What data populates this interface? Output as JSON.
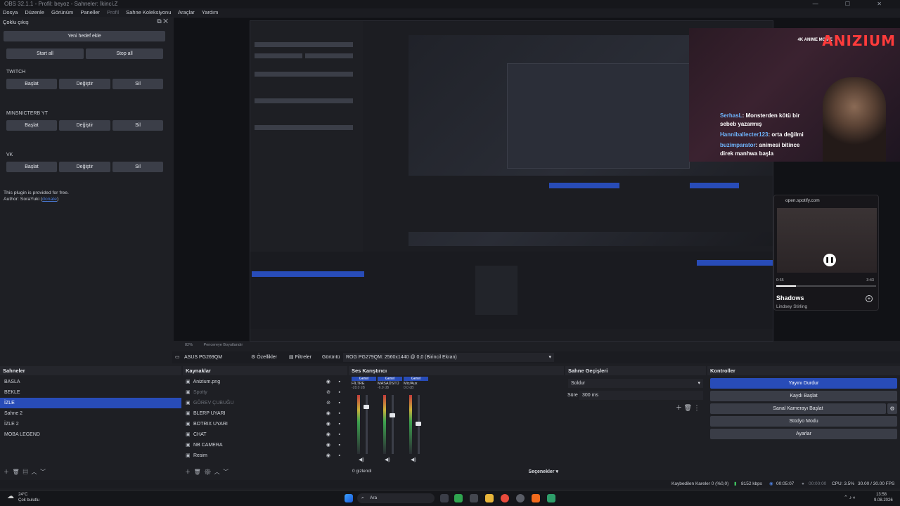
{
  "window": {
    "title": "OBS 32.1.1 - Profil: beyoz - Sahneler: İkinci.Z",
    "controls": "— ☐ ✕"
  },
  "menu": [
    "Dosya",
    "Düzenle",
    "Görünüm",
    "Paneller",
    "Profil",
    "Sahne Koleksiyonu",
    "Araçlar",
    "Yardım"
  ],
  "multi_output": {
    "title": "Çoklu çıkış",
    "add_target": "Yeni hedef ekle",
    "start_all": "Start all",
    "stop_all": "Stop all",
    "targets": [
      {
        "name": "TWITCH",
        "start": "Başlat",
        "edit": "Değiştir",
        "delete": "Sil"
      },
      {
        "name": "MINSNICTERB YT",
        "start": "Başlat",
        "edit": "Değiştir",
        "delete": "Sil"
      },
      {
        "name": "VK",
        "start": "Başlat",
        "edit": "Değiştir",
        "delete": "Sil"
      }
    ],
    "note_line1": "This plugin is provided for free.",
    "note_author": "Author: SoraYuki (",
    "note_link": "donate",
    "note_close": ")"
  },
  "overlay": {
    "logo": "ANIZIUM",
    "logo_sub": "4K ANIME MOVIE",
    "chat": [
      {
        "user": "SerhasL",
        "msg": ": Monsterden kötü bir"
      },
      {
        "user": "",
        "msg": "sebeb yazarmış"
      },
      {
        "user": "Hanniballecter123",
        "msg": ": orta değilmi"
      },
      {
        "user": "buzimparator",
        "msg": ": animesi bitince"
      },
      {
        "user": "",
        "msg": "direk manhwa başla"
      }
    ]
  },
  "spotify": {
    "url": "open.spotify.com",
    "title": "Shadows",
    "artist": "Lindsey Stirling",
    "elapsed": "0:65",
    "total": "3:43",
    "progress": 0.2
  },
  "preview_status": {
    "zoom": "82%",
    "mode": "Pencereye Boyutlandır"
  },
  "source_bar": {
    "source_name": "ASUS PG269QM",
    "properties": "Özellikler",
    "filters": "Filtreler",
    "display_label": "Görüntü",
    "display_value": "ROG PG279QM: 2560x1440 @ 0,0 (Birincil Ekran)"
  },
  "scenes": {
    "title": "Sahneler",
    "items": [
      "BASLA",
      "BEKLE",
      "İZLE",
      "Sahne 2",
      "İZLE 2",
      "MOBA LEGEND"
    ],
    "selected": 2
  },
  "sources": {
    "title": "Kaynaklar",
    "items": [
      {
        "name": "Anizium.png",
        "dim": false
      },
      {
        "name": "Spotty",
        "dim": true
      },
      {
        "name": "GÖREV ÇUBUĞU",
        "dim": true
      },
      {
        "name": "BLERP UYARI",
        "dim": false
      },
      {
        "name": "BOTRIX UYARI",
        "dim": false
      },
      {
        "name": "CHAT",
        "dim": false
      },
      {
        "name": "NB CAMERA",
        "dim": false
      },
      {
        "name": "Resim",
        "dim": false
      }
    ]
  },
  "mixer": {
    "title": "Ses Karıştırıcı",
    "channels": [
      {
        "badge": "Genel",
        "name": "FİLTRE",
        "db": "-28.0 dB"
      },
      {
        "badge": "Genel",
        "name": "MASAÜSTÜ",
        "db": "-6.9 dB"
      },
      {
        "badge": "Genel",
        "name": "Mic/Aux",
        "db": "0.0 dB"
      }
    ],
    "hidden": "0 gizlendi",
    "options": "Seçenekler"
  },
  "transitions": {
    "title": "Sahne Geçişleri",
    "transition": "Soldur",
    "duration_label": "Süre",
    "duration": "300 ms"
  },
  "controls": {
    "title": "Kontroller",
    "stop_stream": "Yayını Durdur",
    "start_record": "Kaydı Başlat",
    "virtual_cam": "Sanal Kamerayı Başlat",
    "studio_mode": "Stüdyo Modu",
    "settings": "Ayarlar"
  },
  "status": {
    "dropped": "Kaybedilen Kareler 0 (%0,0)",
    "bitrate": "8152 kbps",
    "stream_time": "00:05:07",
    "record_time": "00:00:00",
    "cpu": "CPU: 3.5%",
    "fps": "30.00 / 30.00 FPS"
  },
  "taskbar": {
    "weather_temp": "24°C",
    "weather_desc": "Çok bulutlu",
    "search": "Ara",
    "time": "13:58",
    "date": "9.08.2026"
  },
  "colors": {
    "accent": "#284cb8",
    "bg": "#1e1f24",
    "danger": "#ff3b3b"
  }
}
